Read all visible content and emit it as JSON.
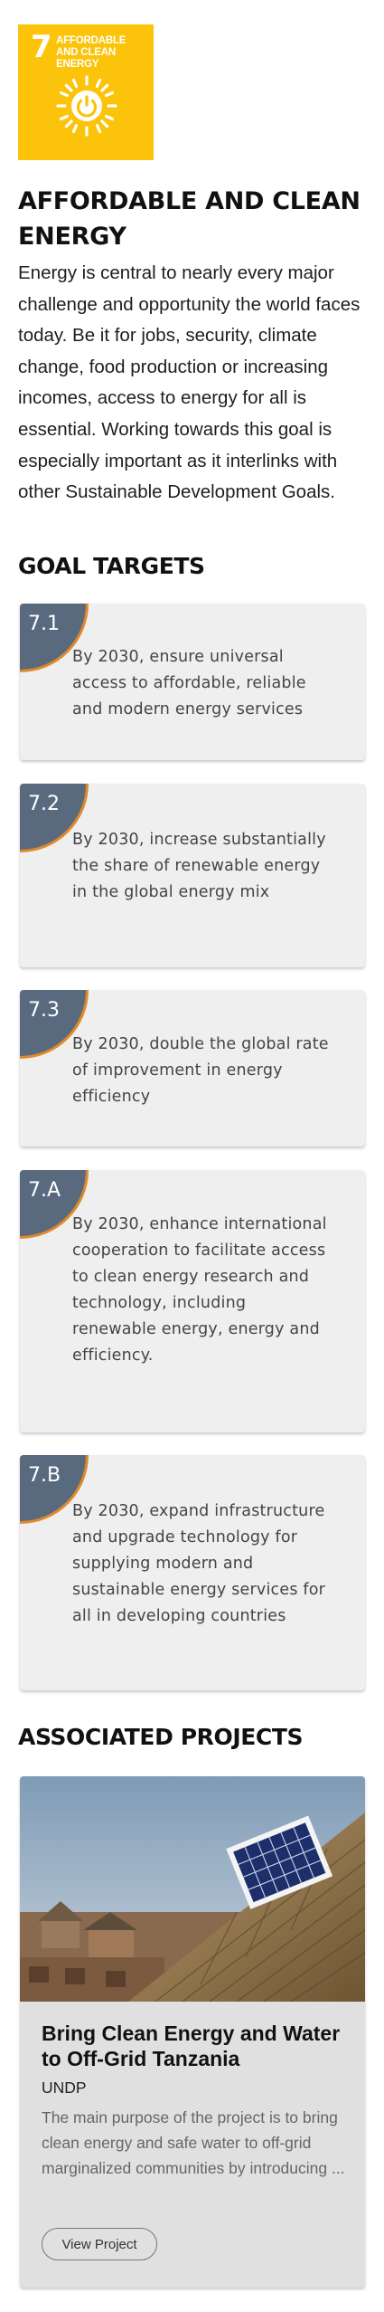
{
  "goal_icon": {
    "number": "7",
    "label": "AFFORDABLE AND CLEAN ENERGY",
    "icon": "sun-power-icon",
    "color": "#FCC30B"
  },
  "title": "AFFORDABLE AND CLEAN ENERGY",
  "intro": "Energy is central to nearly every major challenge and opportunity the world faces today. Be it for jobs, security, climate change, food production or increasing incomes, access to energy for all is essential. Working towards this goal is especially important as it interlinks with other Sustainable Development Goals.",
  "targets_heading": "GOAL TARGETS",
  "targets": [
    {
      "number": "7.1",
      "text": "By 2030, ensure universal access to affordable, reliable and modern energy services"
    },
    {
      "number": "7.2",
      "text": "By 2030, increase substantially the share of renewable energy in the global energy mix"
    },
    {
      "number": "7.3",
      "text": "By 2030, double the global rate of improvement in energy efficiency"
    },
    {
      "number": "7.A",
      "text": "By 2030, enhance international cooperation to facilitate access to clean energy research and technology, including renewable energy, energy and efficiency."
    },
    {
      "number": "7.B",
      "text": "By 2030, expand infrastructure and upgrade technology for supplying modern and sustainable energy services for all in developing countries"
    }
  ],
  "projects_heading": "ASSOCIATED PROJECTS",
  "project": {
    "title": "Bring Clean Energy and Water to Off-Grid Tanzania",
    "organization": "UNDP",
    "description": "The main purpose of the project is to bring clean energy and safe water to off-grid marginalized communities by introducing ...",
    "button_label": "View Project",
    "image": "solar-panel-on-thatched-roof-photo"
  },
  "colors": {
    "target_corner": "#5a6a7e",
    "target_corner_border": "#e0892a",
    "card_background": "#efefef",
    "project_card_background": "#e0e0e0"
  }
}
